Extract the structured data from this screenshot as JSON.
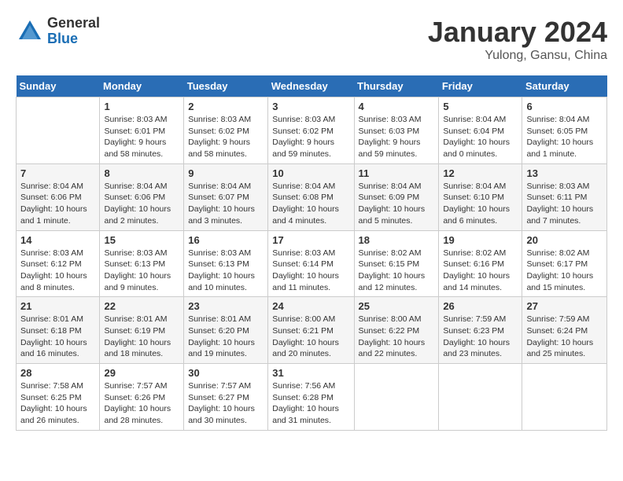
{
  "header": {
    "logo": {
      "general": "General",
      "blue": "Blue"
    },
    "title": "January 2024",
    "location": "Yulong, Gansu, China"
  },
  "days_of_week": [
    "Sunday",
    "Monday",
    "Tuesday",
    "Wednesday",
    "Thursday",
    "Friday",
    "Saturday"
  ],
  "weeks": [
    [
      {
        "day": "",
        "info": ""
      },
      {
        "day": "1",
        "info": "Sunrise: 8:03 AM\nSunset: 6:01 PM\nDaylight: 9 hours\nand 58 minutes."
      },
      {
        "day": "2",
        "info": "Sunrise: 8:03 AM\nSunset: 6:02 PM\nDaylight: 9 hours\nand 58 minutes."
      },
      {
        "day": "3",
        "info": "Sunrise: 8:03 AM\nSunset: 6:02 PM\nDaylight: 9 hours\nand 59 minutes."
      },
      {
        "day": "4",
        "info": "Sunrise: 8:03 AM\nSunset: 6:03 PM\nDaylight: 9 hours\nand 59 minutes."
      },
      {
        "day": "5",
        "info": "Sunrise: 8:04 AM\nSunset: 6:04 PM\nDaylight: 10 hours\nand 0 minutes."
      },
      {
        "day": "6",
        "info": "Sunrise: 8:04 AM\nSunset: 6:05 PM\nDaylight: 10 hours\nand 1 minute."
      }
    ],
    [
      {
        "day": "7",
        "info": "Sunrise: 8:04 AM\nSunset: 6:06 PM\nDaylight: 10 hours\nand 1 minute."
      },
      {
        "day": "8",
        "info": "Sunrise: 8:04 AM\nSunset: 6:06 PM\nDaylight: 10 hours\nand 2 minutes."
      },
      {
        "day": "9",
        "info": "Sunrise: 8:04 AM\nSunset: 6:07 PM\nDaylight: 10 hours\nand 3 minutes."
      },
      {
        "day": "10",
        "info": "Sunrise: 8:04 AM\nSunset: 6:08 PM\nDaylight: 10 hours\nand 4 minutes."
      },
      {
        "day": "11",
        "info": "Sunrise: 8:04 AM\nSunset: 6:09 PM\nDaylight: 10 hours\nand 5 minutes."
      },
      {
        "day": "12",
        "info": "Sunrise: 8:04 AM\nSunset: 6:10 PM\nDaylight: 10 hours\nand 6 minutes."
      },
      {
        "day": "13",
        "info": "Sunrise: 8:03 AM\nSunset: 6:11 PM\nDaylight: 10 hours\nand 7 minutes."
      }
    ],
    [
      {
        "day": "14",
        "info": "Sunrise: 8:03 AM\nSunset: 6:12 PM\nDaylight: 10 hours\nand 8 minutes."
      },
      {
        "day": "15",
        "info": "Sunrise: 8:03 AM\nSunset: 6:13 PM\nDaylight: 10 hours\nand 9 minutes."
      },
      {
        "day": "16",
        "info": "Sunrise: 8:03 AM\nSunset: 6:13 PM\nDaylight: 10 hours\nand 10 minutes."
      },
      {
        "day": "17",
        "info": "Sunrise: 8:03 AM\nSunset: 6:14 PM\nDaylight: 10 hours\nand 11 minutes."
      },
      {
        "day": "18",
        "info": "Sunrise: 8:02 AM\nSunset: 6:15 PM\nDaylight: 10 hours\nand 12 minutes."
      },
      {
        "day": "19",
        "info": "Sunrise: 8:02 AM\nSunset: 6:16 PM\nDaylight: 10 hours\nand 14 minutes."
      },
      {
        "day": "20",
        "info": "Sunrise: 8:02 AM\nSunset: 6:17 PM\nDaylight: 10 hours\nand 15 minutes."
      }
    ],
    [
      {
        "day": "21",
        "info": "Sunrise: 8:01 AM\nSunset: 6:18 PM\nDaylight: 10 hours\nand 16 minutes."
      },
      {
        "day": "22",
        "info": "Sunrise: 8:01 AM\nSunset: 6:19 PM\nDaylight: 10 hours\nand 18 minutes."
      },
      {
        "day": "23",
        "info": "Sunrise: 8:01 AM\nSunset: 6:20 PM\nDaylight: 10 hours\nand 19 minutes."
      },
      {
        "day": "24",
        "info": "Sunrise: 8:00 AM\nSunset: 6:21 PM\nDaylight: 10 hours\nand 20 minutes."
      },
      {
        "day": "25",
        "info": "Sunrise: 8:00 AM\nSunset: 6:22 PM\nDaylight: 10 hours\nand 22 minutes."
      },
      {
        "day": "26",
        "info": "Sunrise: 7:59 AM\nSunset: 6:23 PM\nDaylight: 10 hours\nand 23 minutes."
      },
      {
        "day": "27",
        "info": "Sunrise: 7:59 AM\nSunset: 6:24 PM\nDaylight: 10 hours\nand 25 minutes."
      }
    ],
    [
      {
        "day": "28",
        "info": "Sunrise: 7:58 AM\nSunset: 6:25 PM\nDaylight: 10 hours\nand 26 minutes."
      },
      {
        "day": "29",
        "info": "Sunrise: 7:57 AM\nSunset: 6:26 PM\nDaylight: 10 hours\nand 28 minutes."
      },
      {
        "day": "30",
        "info": "Sunrise: 7:57 AM\nSunset: 6:27 PM\nDaylight: 10 hours\nand 30 minutes."
      },
      {
        "day": "31",
        "info": "Sunrise: 7:56 AM\nSunset: 6:28 PM\nDaylight: 10 hours\nand 31 minutes."
      },
      {
        "day": "",
        "info": ""
      },
      {
        "day": "",
        "info": ""
      },
      {
        "day": "",
        "info": ""
      }
    ]
  ]
}
